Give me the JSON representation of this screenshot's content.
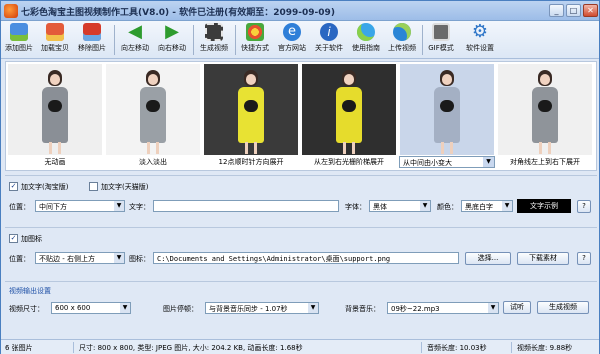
{
  "window": {
    "title": "七彩色淘宝主图视频制作工具(V8.0) - 软件已注册(有效期至：2099-09-09)"
  },
  "toolbar": {
    "items": [
      {
        "label": "添加图片",
        "icon": "add-image-icon"
      },
      {
        "label": "加载宝贝",
        "icon": "load-product-icon"
      },
      {
        "label": "移除图片",
        "icon": "remove-image-icon"
      },
      {
        "label": "向左移动",
        "icon": "arrow-left-icon"
      },
      {
        "label": "向右移动",
        "icon": "arrow-right-icon"
      },
      {
        "label": "生成视频",
        "icon": "generate-video-icon"
      },
      {
        "label": "快捷方式",
        "icon": "shortcut-icon"
      },
      {
        "label": "官方网站",
        "icon": "website-icon"
      },
      {
        "label": "关于软件",
        "icon": "about-icon"
      },
      {
        "label": "使用指南",
        "icon": "guide-icon"
      },
      {
        "label": "上传视频",
        "icon": "upload-video-icon"
      },
      {
        "label": "GIF模式",
        "icon": "gif-mode-icon"
      },
      {
        "label": "软件设置",
        "icon": "settings-icon"
      }
    ]
  },
  "thumbnails": [
    {
      "caption": "无动画",
      "dress": "#8a8f96"
    },
    {
      "caption": "淡入淡出",
      "dress": "#9aa0a6"
    },
    {
      "caption": "12点顺时针方向展开",
      "dress": "#e8e233"
    },
    {
      "caption": "从左到右光栅阶梯展开",
      "dress": "#e6dc2c"
    },
    {
      "caption": "从中间由小变大",
      "dress": "#a4b0c4",
      "is_combo": true
    },
    {
      "caption": "对角线左上到右下展开",
      "dress": "#8f949a"
    }
  ],
  "text_section": {
    "chk_taobao": "加文字(淘宝版)",
    "chk_tmall": "加文字(天猫版)",
    "position_label": "位置：",
    "position_value": "中间下方",
    "text_label": "文字：",
    "text_value": "",
    "font_label": "字体：",
    "font_value": "黑体",
    "color_label": "颜色：",
    "color_value": "黑底白字",
    "sample_label": "文字示例",
    "help": "?"
  },
  "logo_section": {
    "chk_logo": "加图标",
    "position_label": "位置：",
    "position_value": "不贴边 - 右侧上方",
    "icon_label": "图标：",
    "icon_path": "C:\\Documents and Settings\\Administrator\\桌面\\support.png",
    "choose_button": "选择...",
    "download_button": "下载素材",
    "help": "?"
  },
  "video_section": {
    "title": "视频输出设置",
    "size_label": "视频尺寸：",
    "size_value": "600 x 600",
    "pause_label": "图片停顿：",
    "pause_value": "与背景音乐同步 - 1.07秒",
    "music_label": "背景音乐：",
    "music_value": "09秒~22.mp3",
    "listen_button": "试听",
    "generate_button": "生成视频"
  },
  "status": {
    "count": "6 张图片",
    "info": "尺寸: 800 x 800, 类型: JPEG 图片, 大小: 204.2 KB, 动画长度: 1.68秒",
    "audio": "音频长度: 10.03秒",
    "video": "视频长度: 9.88秒"
  },
  "colors": {
    "title_blue": "#1d4fa6",
    "sample_bg": "#000000"
  }
}
